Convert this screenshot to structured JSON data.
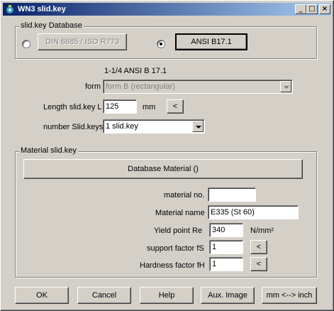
{
  "window": {
    "title": "WN3 slid.key",
    "minimize_label": "_",
    "maximize_label": "□",
    "close_label": "×"
  },
  "database": {
    "group_title": "slid.key Database",
    "option1_label": "DIN 6885 / ISO R773",
    "option2_label": "ANSI B17.1",
    "selected": "ANSI B17.1"
  },
  "spec_title": "1-1/4 ANSI B 17.1",
  "form": {
    "label": "form",
    "value": "form B (rectangular)"
  },
  "length": {
    "label": "Length slid.key L",
    "value": "125",
    "unit": "mm",
    "button_label": "<"
  },
  "number": {
    "label": "number Slid.keys",
    "value": "1 slid.key"
  },
  "material": {
    "group_title": "Material slid.key",
    "db_button_label": "Database Material  ()",
    "material_no_label": "material no.",
    "material_no_value": "",
    "name_label": "Material name",
    "name_value": "E335 (St 60)",
    "yield_label": "Yield point Re",
    "yield_value": "340",
    "yield_unit": "N/mm²",
    "support_label": "support factor fS",
    "support_value": "1",
    "support_button": "<",
    "hardness_label": "Hardness factor fH",
    "hardness_value": "1",
    "hardness_button": "<"
  },
  "buttons": {
    "ok": "OK",
    "cancel": "Cancel",
    "help": "Help",
    "aux_image": "Aux. Image",
    "units": "mm <--> inch"
  }
}
